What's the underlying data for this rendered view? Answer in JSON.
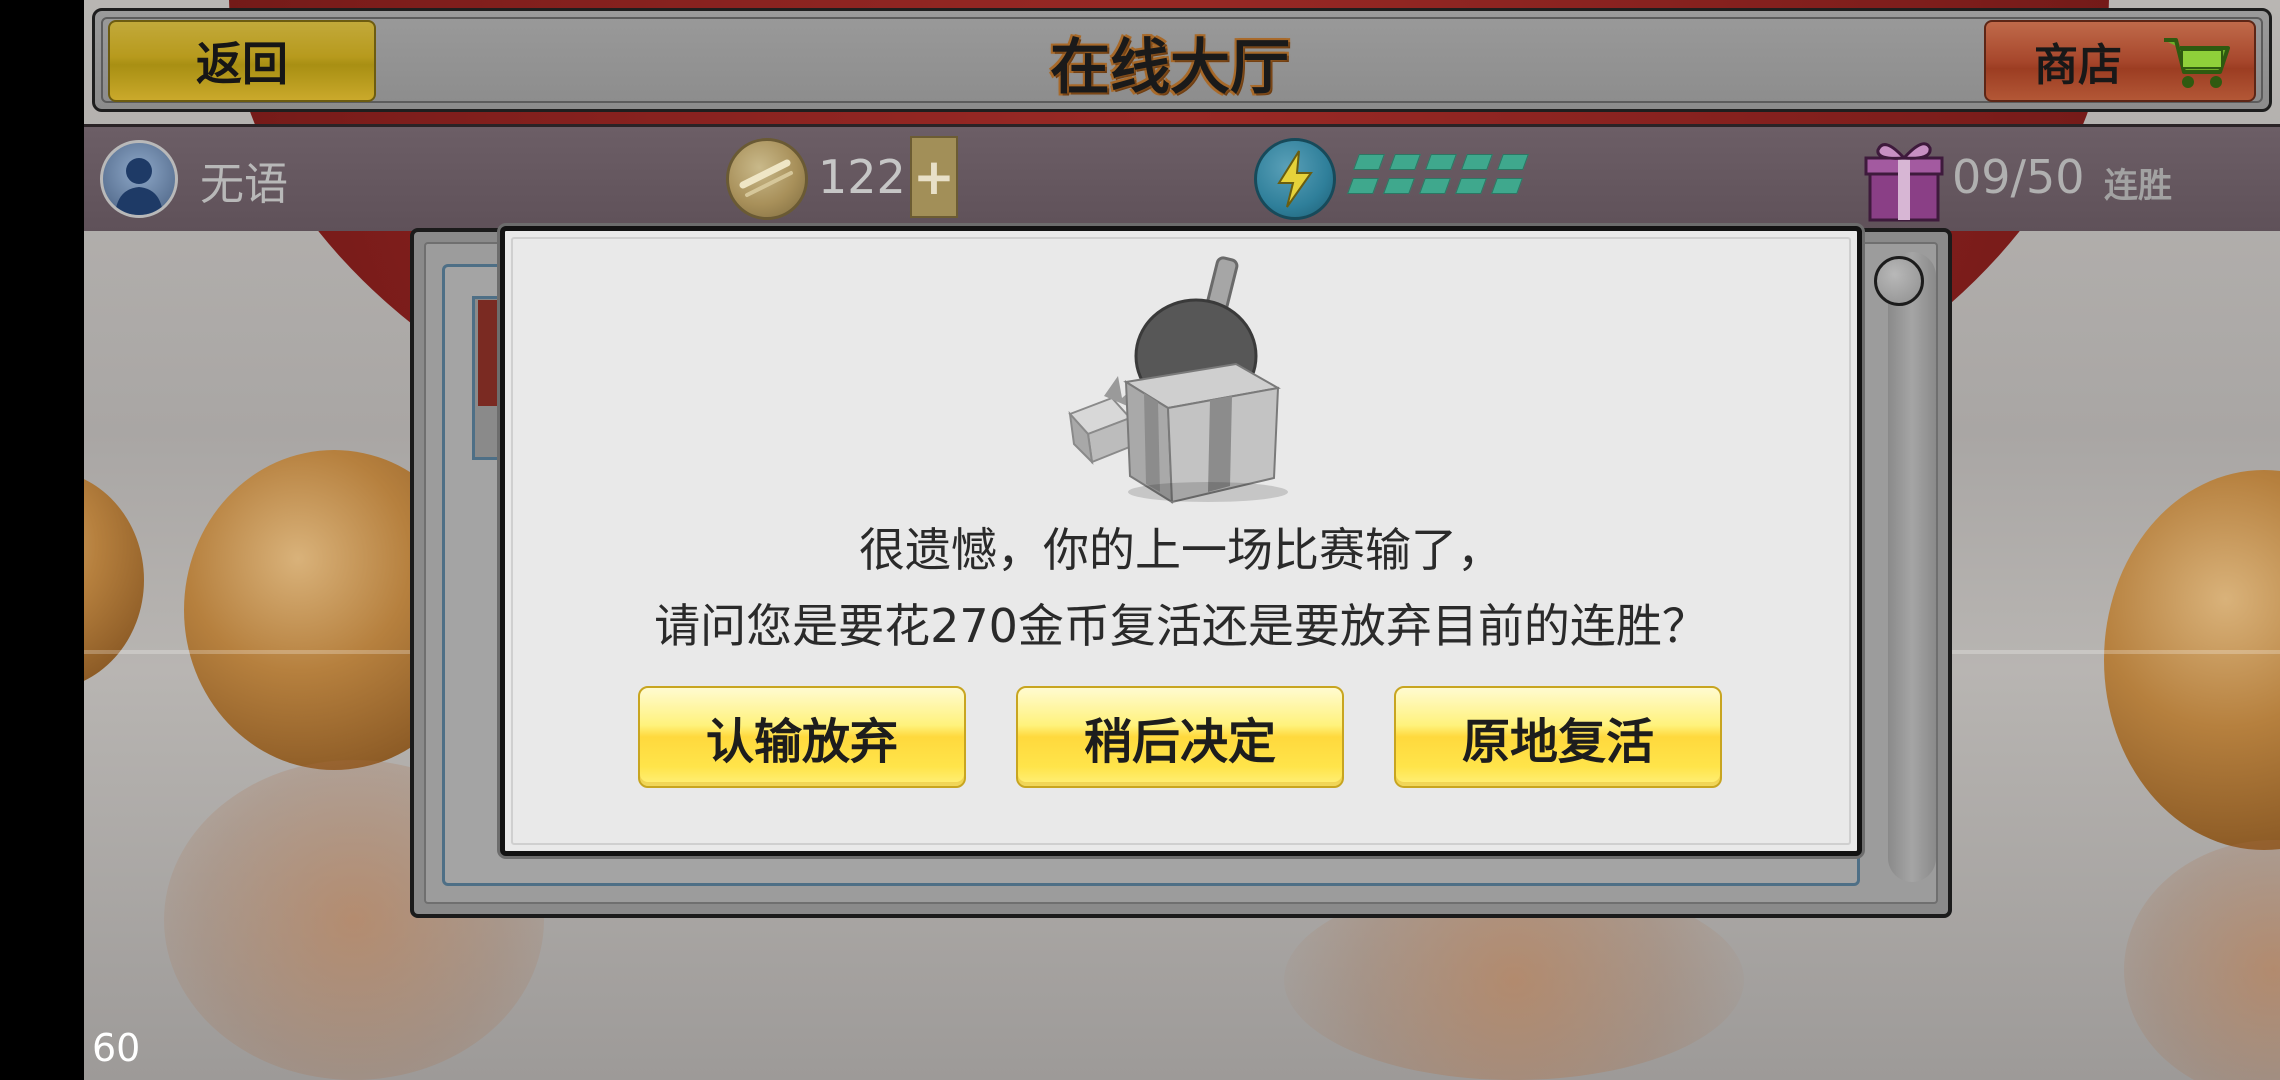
{
  "header": {
    "back_label": "返回",
    "title": "在线大厅",
    "shop_label": "商店"
  },
  "status": {
    "username": "无语",
    "coins": "122",
    "plus_label": "+",
    "energy_cells": 10,
    "streak": "09/50",
    "streak_label": "连胜"
  },
  "dialog": {
    "message_line1": "很遗憾，你的上一场比赛输了，",
    "message_line2": "请问您是要花270金币复活还是要放弃目前的连胜？",
    "buttons": [
      {
        "label": "认输放弃"
      },
      {
        "label": "稍后决定"
      },
      {
        "label": "原地复活"
      }
    ]
  },
  "overlay": {
    "fps": "60"
  },
  "colors": {
    "button_yellow": "#ffe44a",
    "back_button": "#b79a1d",
    "shop_button": "#a7472c",
    "status_bar": "#5f5159",
    "energy": "#3fa88d"
  },
  "icons": [
    "user-avatar-icon",
    "coin-icon",
    "lightning-icon",
    "gift-box-icon",
    "shopping-cart-icon",
    "paddle-gift-icon"
  ]
}
